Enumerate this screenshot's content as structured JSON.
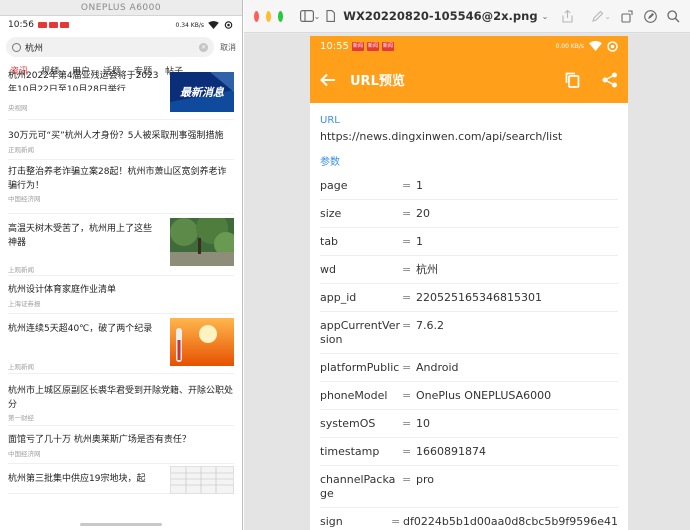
{
  "phone": {
    "window_title": "ONEPLUS A6000",
    "status_time": "10:56",
    "status_right": "0.34 KB/s",
    "search_query": "杭州",
    "search_cancel": "取消",
    "tabs": [
      "资讯",
      "视频",
      "用户",
      "话题",
      "专题",
      "帖子"
    ],
    "active_tab": "资讯",
    "news": [
      {
        "title": "杭州2022年第4届亚残运会将于2023年10月22日至10月28日举行",
        "source": "央视网",
        "thumb": "最新消息"
      },
      {
        "title": "30万元可“买”杭州人才身份？5人被采取刑事强制措施",
        "source": "正观新闻"
      },
      {
        "title": "打击整治养老诈骗立案28起！杭州市萧山区宽剑养老诈骗行为！",
        "source": "中国经济网"
      },
      {
        "title": "高温天树木受苦了，杭州用上了这些神器",
        "source": "上观新闻"
      },
      {
        "title": "杭州设计体育家庭作业清单",
        "source": "上海证券报"
      },
      {
        "title": "杭州连续5天超40℃，破了两个纪录",
        "source": "上观新闻"
      },
      {
        "title": "杭州市上城区原副区长裘华君受到开除党籍、开除公职处分",
        "source": "第一财经"
      },
      {
        "title": "面馆亏了几十万 杭州奥莱斯广场是否有责任？",
        "source": "中国经济网"
      },
      {
        "title": "杭州第三批集中供应19宗地块，起",
        "source": ""
      }
    ]
  },
  "viewer": {
    "filename": "WX20220820-105546@2x.png",
    "colors": {
      "red": "#ff5f57",
      "yellow": "#febc2e",
      "green": "#28c840"
    }
  },
  "app": {
    "status_time": "10:55",
    "status_badges": [
      "新闻",
      "新闻",
      "新闻"
    ],
    "status_right": "0.00 KB/s",
    "title": "URL预览",
    "accent": "#ff9f1a",
    "url_label": "URL",
    "url_value": "https://news.dingxinwen.com/api/search/list",
    "params_label": "参数",
    "params": [
      {
        "k": "page",
        "v": "1"
      },
      {
        "k": "size",
        "v": "20"
      },
      {
        "k": "tab",
        "v": "1"
      },
      {
        "k": "wd",
        "v": "杭州"
      },
      {
        "k": "app_id",
        "v": "220525165346815301"
      },
      {
        "k": "appCurrentVersion",
        "v": "7.6.2"
      },
      {
        "k": "platformPublic",
        "v": "Android"
      },
      {
        "k": "phoneModel",
        "v": "OnePlus ONEPLUSA6000"
      },
      {
        "k": "systemOS",
        "v": "10"
      },
      {
        "k": "timestamp",
        "v": "1660891874"
      },
      {
        "k": "channelPackage",
        "v": "pro"
      },
      {
        "k": "sign",
        "v": "df0224b5b1d00aa0d8cbc5b9f9596e41"
      }
    ],
    "eq": "="
  }
}
